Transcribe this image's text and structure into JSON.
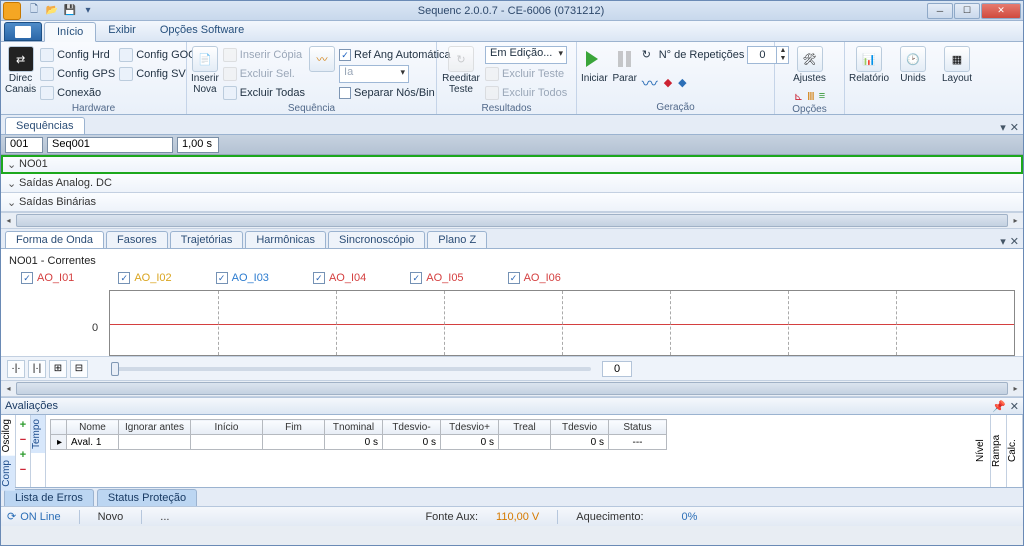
{
  "title": "Sequenc 2.0.0.7 - CE-6006 (0731212)",
  "menu": {
    "inicio": "Início",
    "exibir": "Exibir",
    "opcoes": "Opções Software"
  },
  "ribbon": {
    "hardware": {
      "direc": "Direc\nCanais",
      "configHrd": "Config Hrd",
      "configGoose": "Config GOOSE",
      "configGps": "Config GPS",
      "configSv": "Config SV",
      "conexao": "Conexão",
      "label": "Hardware"
    },
    "seq": {
      "inserirNova": "Inserir  Nova",
      "inserirCopia": "Inserir Cópia",
      "excluirSel": "Excluir Sel.",
      "excluirTodas": "Excluir Todas",
      "refAng": "Ref Ang Automática",
      "iaSel": "Ia",
      "separar": "Separar Nós/Bin",
      "label": "Sequência"
    },
    "res": {
      "reeditar": "Reeditar  Teste",
      "emEdicao": "Em Edição...",
      "excluirTeste": "Excluir Teste",
      "excluirTodos": "Excluir Todos",
      "label": "Resultados"
    },
    "ger": {
      "iniciar": "Iniciar",
      "parar": "Parar",
      "nrep": "N° de Repetições",
      "nrepVal": "0",
      "label": "Geração"
    },
    "opc": {
      "ajustes": "Ajustes",
      "label": "Opções"
    },
    "right": {
      "relatorio": "Relatório",
      "unids": "Unids",
      "layout": "Layout"
    }
  },
  "sequencias": {
    "tab": "Sequências",
    "id": "001",
    "name": "Seq001",
    "dur": "1,00 s"
  },
  "rows": {
    "no01": "NO01",
    "saidasAnalog": "Saídas Analog. DC",
    "saidasBin": "Saídas Binárias"
  },
  "wave": {
    "tabForma": "Forma de Onda",
    "tabFasores": "Fasores",
    "tabTraj": "Trajetórias",
    "tabHarm": "Harmônicas",
    "tabSinc": "Sincronoscópio",
    "tabPlanoZ": "Plano Z",
    "title": "NO01 - Correntes",
    "ch1": "AO_I01",
    "ch2": "AO_I02",
    "ch3": "AO_I03",
    "ch4": "AO_I04",
    "ch5": "AO_I05",
    "ch6": "AO_I06",
    "zero": "0",
    "zoomVal": "0"
  },
  "aval": {
    "title": "Avaliações",
    "tabComp": "Comp",
    "tabTempo": "Tempo",
    "tabOsc": "Oscilog",
    "colNome": "Nome",
    "colIgnorar": "Ignorar antes",
    "colInicio": "Início",
    "colFim": "Fim",
    "colTnom": "Tnominal",
    "colTdm": "Tdesvio-",
    "colTdp": "Tdesvio+",
    "colTreal": "Treal",
    "colTdes": "Tdesvio",
    "colStatus": "Status",
    "r1Nome": "Aval. 1",
    "zero": "0 s",
    "dash": "---",
    "tabNivel": "Nível",
    "tabRampa": "Rampa",
    "tabCalc": "Calc."
  },
  "bottom": {
    "erros": "Lista de Erros",
    "status": "Status Proteção"
  },
  "status": {
    "online": "ON Line",
    "novo": "Novo",
    "dots": "...",
    "fonte": "Fonte Aux:",
    "fonteV": "110,00 V",
    "aquec": "Aquecimento:",
    "aquecV": "0%"
  }
}
